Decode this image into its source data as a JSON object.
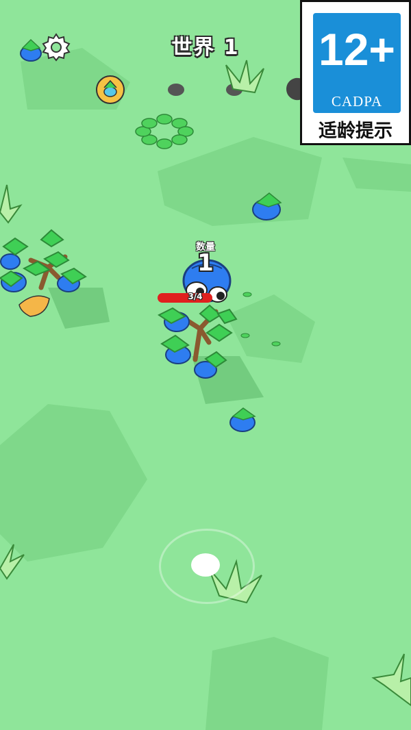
{
  "hud": {
    "world_label": "世界  1",
    "settings_icon": "gear-icon"
  },
  "age_rating": {
    "number": "12+",
    "org": "CADPA",
    "caption": "适龄提示"
  },
  "player": {
    "count_label": "数量",
    "count_value": "1",
    "health_text": "3/4"
  },
  "colors": {
    "ground": "#8fe59a",
    "ground_dark": "#7fd88a",
    "player_blue": "#2e7df0",
    "leaf_green": "#3fcf55",
    "health_red": "#e0201f",
    "rating_blue": "#1a8fd8"
  }
}
